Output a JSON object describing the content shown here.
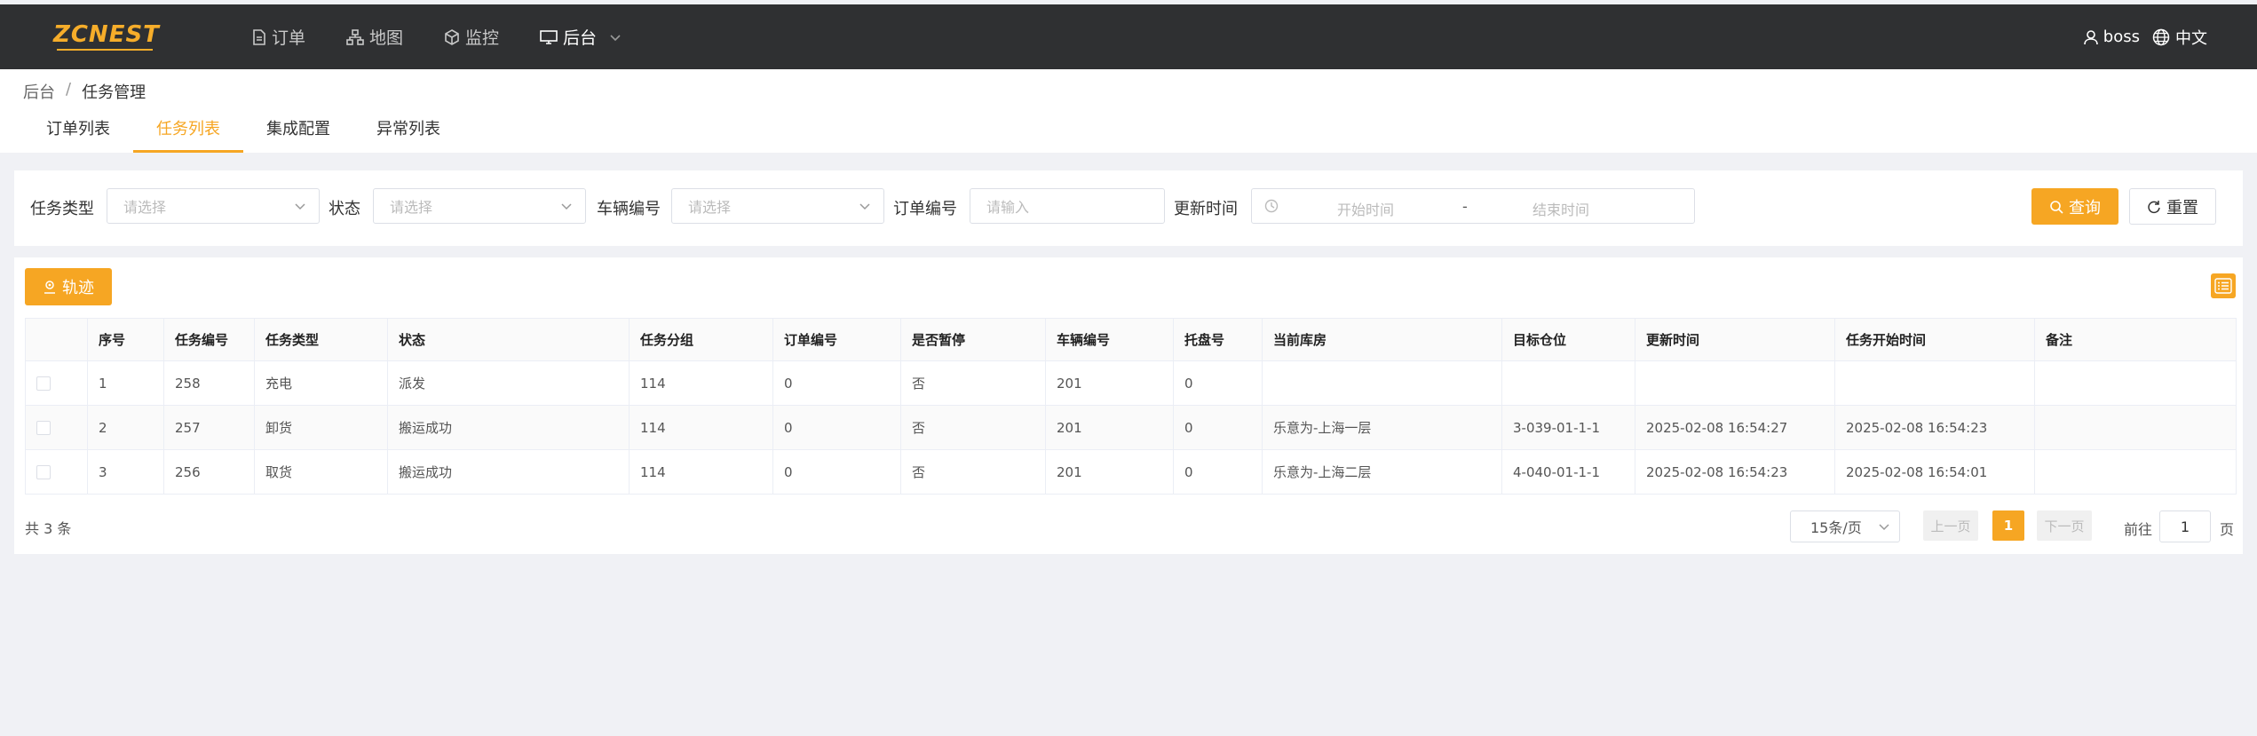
{
  "app": {
    "logo_text": "ZCNEST"
  },
  "nav": {
    "items": [
      {
        "label": "订单",
        "icon": "document-icon"
      },
      {
        "label": "地图",
        "icon": "sitemap-icon"
      },
      {
        "label": "监控",
        "icon": "cube-icon"
      },
      {
        "label": "后台",
        "icon": "monitor-icon"
      }
    ],
    "user": "boss",
    "language": "中文"
  },
  "breadcrumb": {
    "root": "后台",
    "sep": "/",
    "current": "任务管理"
  },
  "tabs": [
    {
      "label": "订单列表"
    },
    {
      "label": "任务列表",
      "active": true
    },
    {
      "label": "集成配置"
    },
    {
      "label": "异常列表"
    }
  ],
  "filters": {
    "task_type": {
      "label": "任务类型",
      "placeholder": "请选择"
    },
    "status": {
      "label": "状态",
      "placeholder": "请选择"
    },
    "vehicle": {
      "label": "车辆编号",
      "placeholder": "请选择"
    },
    "order": {
      "label": "订单编号",
      "placeholder": "请输入"
    },
    "update_time": {
      "label": "更新时间",
      "start": "开始时间",
      "sep": "-",
      "end": "结束时间"
    },
    "query_label": "查询",
    "reset_label": "重置"
  },
  "toolbar": {
    "track_label": "轨迹"
  },
  "table": {
    "columns": [
      "",
      "序号",
      "任务编号",
      "任务类型",
      "状态",
      "任务分组",
      "订单编号",
      "是否暂停",
      "车辆编号",
      "托盘号",
      "当前库房",
      "目标仓位",
      "更新时间",
      "任务开始时间",
      "备注"
    ],
    "rows": [
      [
        "",
        "1",
        "258",
        "充电",
        "派发",
        "114",
        "0",
        "否",
        "201",
        "0",
        "",
        "",
        "",
        "",
        ""
      ],
      [
        "",
        "2",
        "257",
        "卸货",
        "搬运成功",
        "114",
        "0",
        "否",
        "201",
        "0",
        "乐意为-上海一层",
        "3-039-01-1-1",
        "2025-02-08 16:54:27",
        "2025-02-08 16:54:23",
        ""
      ],
      [
        "",
        "3",
        "256",
        "取货",
        "搬运成功",
        "114",
        "0",
        "否",
        "201",
        "0",
        "乐意为-上海二层",
        "4-040-01-1-1",
        "2025-02-08 16:54:23",
        "2025-02-08 16:54:01",
        ""
      ]
    ]
  },
  "pagination": {
    "total": "共 3 条",
    "page_size": "15条/页",
    "prev": "上一页",
    "current": "1",
    "next": "下一页",
    "goto_label": "前往",
    "goto_value": "1",
    "page_suffix": "页"
  },
  "colors": {
    "accent": "#f6a623",
    "topbar": "#2f3032"
  }
}
